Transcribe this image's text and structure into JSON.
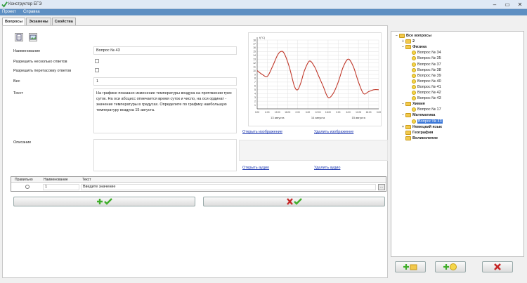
{
  "window": {
    "title": "Конструктор ЕГЭ"
  },
  "menu": [
    {
      "label": "Проект"
    },
    {
      "label": "Справка"
    }
  ],
  "tabs": [
    {
      "label": "Вопросы"
    },
    {
      "label": "Экзамены"
    },
    {
      "label": "Свойства"
    }
  ],
  "form": {
    "name_label": "Наименование",
    "name_value": "Вопрос № 43",
    "multi_label": "Разрешить несколько ответов",
    "mixed_label": "Разрешить перетасовку ответов",
    "weight_label": "Вес",
    "weight_value": "1",
    "text_label": "Текст",
    "text_value": "На графике показано изменение температуры воздуха на протяжении трех суток. На оси абсцисс отмечается время суток и число, на оси ординат - значение температуры в градусах. Определите по графику наибольшую температуру воздуха 15 августа.",
    "description_label": "Описание",
    "description_value": ""
  },
  "links": {
    "open_image": "Открыть изображение",
    "delete_image": "Удалить изображение",
    "open_audio": "Открыть аудио",
    "delete_audio": "Удалить аудио"
  },
  "chart_data": {
    "type": "line",
    "ylabel": "t(°C)",
    "y_ticks": [
      "1",
      "2",
      "3",
      "4",
      "5",
      "6",
      "7",
      "8",
      "9",
      "10",
      "11",
      "12",
      "13",
      "14",
      "15",
      "16",
      "17",
      "18"
    ],
    "ylim": [
      0,
      18
    ],
    "x_ticks": [
      "0:00",
      "6:00",
      "12:00",
      "18:00",
      "0:00",
      "6:00",
      "12:00",
      "18:00",
      "0:00",
      "6:00",
      "12:00",
      "18:00",
      "0:00"
    ],
    "day_labels": [
      "13 августа",
      "14 августа",
      "15 августа"
    ],
    "xlim": [
      0,
      72
    ],
    "grid": true,
    "series": [
      {
        "color": "#c0392b",
        "points": [
          [
            0,
            10
          ],
          [
            3,
            9
          ],
          [
            6,
            8.5
          ],
          [
            9,
            11
          ],
          [
            12,
            14
          ],
          [
            14,
            15
          ],
          [
            16,
            14.5
          ],
          [
            19,
            11
          ],
          [
            22,
            6
          ],
          [
            24,
            5
          ],
          [
            26,
            7
          ],
          [
            28,
            10
          ],
          [
            31,
            12.5
          ],
          [
            34,
            11
          ],
          [
            36,
            9
          ],
          [
            39,
            6
          ],
          [
            42,
            3
          ],
          [
            45,
            4
          ],
          [
            48,
            7
          ],
          [
            51,
            11
          ],
          [
            54,
            13
          ],
          [
            57,
            11
          ],
          [
            60,
            7
          ],
          [
            63,
            4
          ],
          [
            66,
            4.5
          ],
          [
            69,
            5
          ],
          [
            72,
            5
          ]
        ]
      }
    ]
  },
  "answers": {
    "headers": {
      "correct": "Правильно",
      "order": "Наименование",
      "text": "Текст"
    },
    "rows": [
      {
        "order": "1",
        "text": "Введите значение"
      }
    ]
  },
  "buttons": {
    "browse": "..."
  },
  "tree": [
    {
      "label": "Все вопросы",
      "level": 0,
      "kind": "folder",
      "bold": true,
      "expander": "–"
    },
    {
      "label": "2",
      "level": 1,
      "kind": "folder",
      "bold": true,
      "expander": "+"
    },
    {
      "label": "Физика",
      "level": 1,
      "kind": "folder",
      "bold": true,
      "expander": "–"
    },
    {
      "label": "Вопрос № 34",
      "level": 2,
      "kind": "question"
    },
    {
      "label": "Вопрос № 35",
      "level": 2,
      "kind": "question"
    },
    {
      "label": "Вопрос № 37",
      "level": 2,
      "kind": "question"
    },
    {
      "label": "Вопрос № 38",
      "level": 2,
      "kind": "question"
    },
    {
      "label": "Вопрос № 39",
      "level": 2,
      "kind": "question"
    },
    {
      "label": "Вопрос № 40",
      "level": 2,
      "kind": "question"
    },
    {
      "label": "Вопрос № 41",
      "level": 2,
      "kind": "question"
    },
    {
      "label": "Вопрос № 42",
      "level": 2,
      "kind": "question"
    },
    {
      "label": "Вопрос № 43",
      "level": 2,
      "kind": "question"
    },
    {
      "label": "Химия",
      "level": 1,
      "kind": "folder",
      "bold": true,
      "expander": "–"
    },
    {
      "label": "Вопрос № 17",
      "level": 2,
      "kind": "question"
    },
    {
      "label": "Математика",
      "level": 1,
      "kind": "folder",
      "bold": true,
      "expander": "–"
    },
    {
      "label": "Вопрос № 43",
      "level": 2,
      "kind": "question",
      "selected": true
    },
    {
      "label": "Немецкий язык",
      "level": 1,
      "kind": "folder",
      "bold": true,
      "expander": "+"
    },
    {
      "label": "География",
      "level": 1,
      "kind": "folder",
      "bold": true,
      "expander": ""
    },
    {
      "label": "Великолепие",
      "level": 1,
      "kind": "folder",
      "bold": true,
      "expander": ""
    }
  ],
  "icons": {
    "accept": "green-plus-check-icon",
    "cancel": "red-x-check-icon",
    "add_folder": "add-folder-icon",
    "add_question": "add-question-icon",
    "delete": "red-x-icon"
  },
  "colors": {
    "menubar": "#5e8fc2",
    "chart_line": "#c0392b",
    "link": "#1a35b0",
    "selection": "#3875d7"
  }
}
